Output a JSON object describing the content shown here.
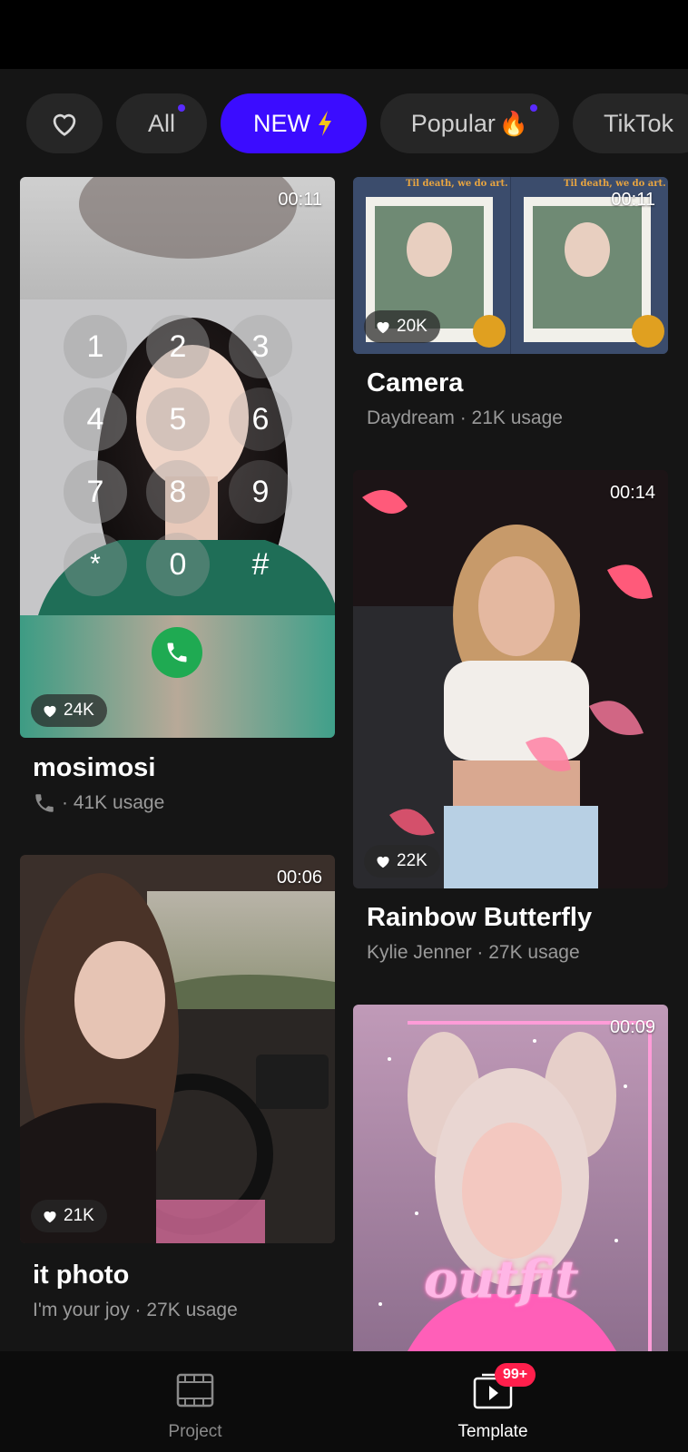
{
  "tabs": [
    {
      "label": "",
      "icon": "heart-outline-icon"
    },
    {
      "label": "All"
    },
    {
      "label": "NEW",
      "icon": "lightning-icon"
    },
    {
      "label": "Popular",
      "icon": "fire-icon"
    },
    {
      "label": "TikTok"
    }
  ],
  "cards": {
    "mosimosi": {
      "duration": "00:11",
      "likes": "24K",
      "title": "mosimosi",
      "subtitle": "· 41K usage",
      "subtitle_icon": "phone-icon"
    },
    "camera": {
      "duration": "00:11",
      "likes": "20K",
      "title": "Camera",
      "subtitle": "Daydream · 21K usage"
    },
    "it_photo": {
      "duration": "00:06",
      "likes": "21K",
      "title": "it photo",
      "subtitle": "I'm your joy · 27K usage"
    },
    "rainbow_butterfly": {
      "duration": "00:14",
      "likes": "22K",
      "title": "Rainbow Butterfly",
      "subtitle": "Kylie Jenner · 27K usage"
    },
    "outfit": {
      "duration": "00:09",
      "overlay_text": "outfit"
    }
  },
  "dialpad": {
    "keys": [
      "1",
      "2",
      "3",
      "4",
      "5",
      "6",
      "7",
      "8",
      "9",
      "*",
      "0",
      "#"
    ]
  },
  "camera_card_text": "Til death, we do art.",
  "nav": {
    "project_label": "Project",
    "template_label": "Template",
    "template_badge": "99+"
  },
  "colors": {
    "accent": "#3b0cff",
    "badge": "#ff1f4c",
    "background": "#151515"
  }
}
